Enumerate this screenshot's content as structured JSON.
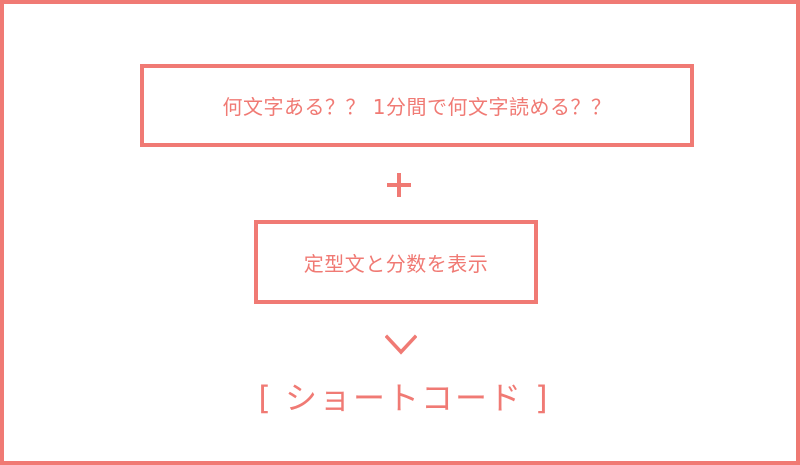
{
  "colors": {
    "accent": "#f07a74",
    "background": "#ffffff"
  },
  "diagram": {
    "top_box_text": "何文字ある？？ 1分間で何文字読める？？",
    "plus_symbol": "+",
    "middle_box_text": "定型文と分数を表示",
    "arrow_icon": "chevron-down-icon",
    "result_text": "[ ショートコード ]"
  }
}
